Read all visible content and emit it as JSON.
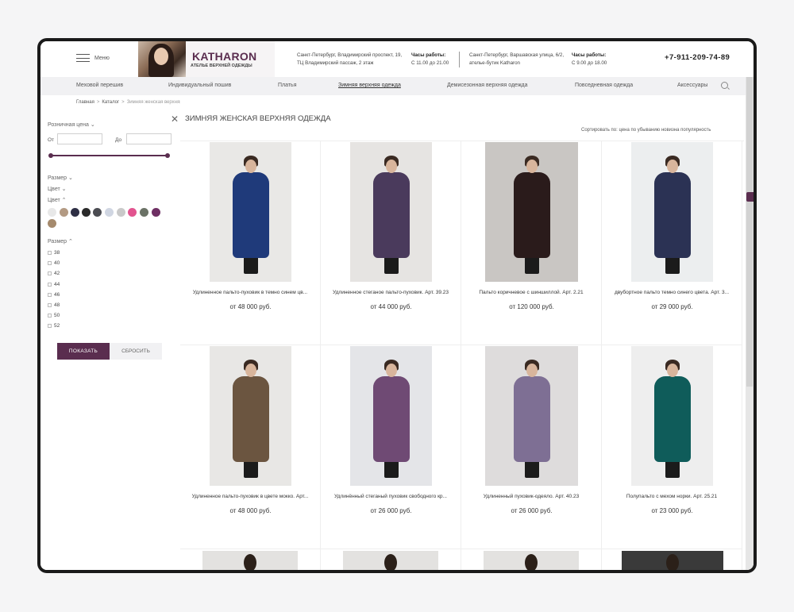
{
  "header": {
    "menu_label": "Меню",
    "brand": "KATHARON",
    "brand_sub": "АТЕЛЬЕ ВЕРХНЕЙ ОДЕЖДЫ",
    "addr1_line1": "Санкт-Петербург, Владимирский проспект, 19,",
    "addr1_line2": "ТЦ Владимирский пассаж, 2 этаж",
    "hours1_title": "Часы работы:",
    "hours1": "С 11.00 до 21.00",
    "addr2_line1": "Санкт-Петербург, Варшавская улица, 6/2,",
    "addr2_line2": "ателье-бутик Katharon",
    "hours2_title": "Часы работы:",
    "hours2": "С 9.00 до 18.00",
    "phone": "+7-911-209-74-89"
  },
  "nav": {
    "items": [
      {
        "label": "Меховой перешив"
      },
      {
        "label": "Индивидуальный пошив"
      },
      {
        "label": "Платья"
      },
      {
        "label": "Зимняя верхняя одежда"
      },
      {
        "label": "Демисезонная верхняя одежда"
      },
      {
        "label": "Повседневная одежда"
      },
      {
        "label": "Аксессуары"
      }
    ]
  },
  "breadcrumb": {
    "home": "Главная",
    "catalog": "Каталог",
    "current": "Зимняя женская верхняя одежда",
    "sep": ">"
  },
  "filters": {
    "price_title": "Розничная цена",
    "from_label": "От",
    "to_label": "До",
    "size_collapsed": "Размер",
    "color_collapsed": "Цвет",
    "color_expanded": "Цвет",
    "size_expanded": "Размер",
    "colors": [
      "#e8e8e8",
      "#b39a83",
      "#2e2f45",
      "#2a2a2a",
      "#4b4c52",
      "#d0d6e2",
      "#c9c9c9",
      "#e2548f",
      "#6b7266",
      "#6e2f63",
      "#a58a6d"
    ],
    "sizes": [
      "38",
      "40",
      "42",
      "44",
      "46",
      "48",
      "50",
      "52"
    ],
    "show_button": "ПОКАЗАТЬ",
    "reset_button": "СБРОСИТЬ"
  },
  "main": {
    "title": "ЗИМНЯЯ ЖЕНСКАЯ ВЕРХНЯЯ ОДЕЖДА",
    "sort_label": "Сортировать по:",
    "sort_options": [
      "цена по убыванию",
      "новизна",
      "популярность"
    ]
  },
  "products": [
    {
      "name": "Удлиненное пальто-пуховик в темно синем цв...",
      "price": "от 48 000 руб.",
      "color": "#1f3a7a",
      "bg": "#e9e8e6"
    },
    {
      "name": "Удлиненное стеганое пальто-пуховик. Арт. 39.23",
      "price": "от 44 000 руб.",
      "color": "#4a3a5c",
      "bg": "#e6e4e2"
    },
    {
      "name": "Пальто коричневое с шиншиллой. Арт. 2.21",
      "price": "от 120 000 руб.",
      "color": "#2a1b1b",
      "bg": "#c9c6c3"
    },
    {
      "name": "двубортное пальто темно синего цвета. Арт. 3...",
      "price": "от 29 000 руб.",
      "color": "#2b3254",
      "bg": "#eceeef"
    },
    {
      "name": "Удлиненное пальто-пуховик в цвете мокко. Арт...",
      "price": "от 48 000 руб.",
      "color": "#6b5540",
      "bg": "#e8e7e5"
    },
    {
      "name": "Удлинённый стеганый пуховик свободного кр...",
      "price": "от 26 000 руб.",
      "color": "#6f4a74",
      "bg": "#e4e5e8"
    },
    {
      "name": "Удлиненный пуховик-одеяло. Арт. 40.23",
      "price": "от 26 000 руб.",
      "color": "#7e6f94",
      "bg": "#dedcdc"
    },
    {
      "name": "Полупальто с мехом норки. Арт. 25.21",
      "price": "от 23 000 руб.",
      "color": "#0f5c5a",
      "bg": "#eeeeee"
    }
  ]
}
